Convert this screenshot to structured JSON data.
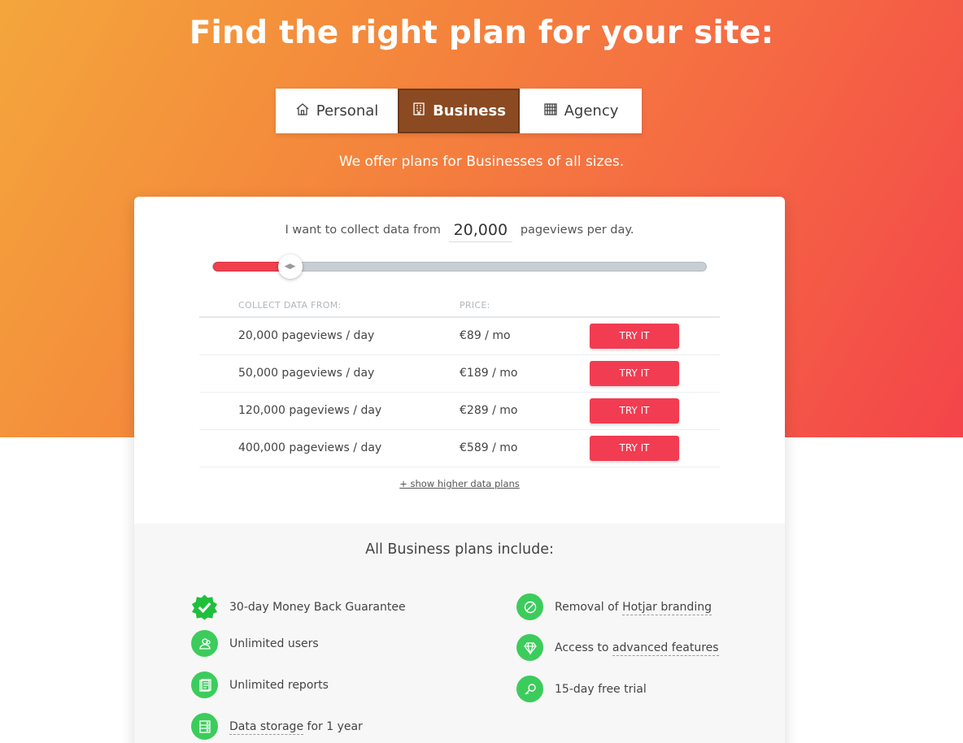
{
  "header": {
    "title": "Find the right plan for your site:",
    "subtitle": "We offer plans for Businesses of all sizes."
  },
  "tabs": [
    {
      "label": "Personal",
      "icon": "house-icon",
      "active": false
    },
    {
      "label": "Business",
      "icon": "office-building-icon",
      "active": true
    },
    {
      "label": "Agency",
      "icon": "skyscraper-icon",
      "active": false
    }
  ],
  "collector": {
    "prefix": "I want to collect data from",
    "value": "20,000",
    "suffix": "pageviews per day."
  },
  "slider": {
    "level": 0.156,
    "fill_color": "#f0404e"
  },
  "table": {
    "headers": [
      "COLLECT DATA FROM:",
      "PRICE:"
    ],
    "rows": [
      {
        "data": "20,000 pageviews / day",
        "price": "€89 / mo",
        "button": "TRY IT"
      },
      {
        "data": "50,000 pageviews / day",
        "price": "€189 / mo",
        "button": "TRY IT"
      },
      {
        "data": "120,000 pageviews / day",
        "price": "€289 / mo",
        "button": "TRY IT"
      },
      {
        "data": "400,000 pageviews / day",
        "price": "€589 / mo",
        "button": "TRY IT"
      }
    ],
    "show_more": "+ show higher data plans"
  },
  "includes": {
    "title": "All Business plans include:",
    "left": [
      {
        "icon": "verified-badge-icon",
        "text": "30-day Money Back Guarantee"
      },
      {
        "icon": "users-icon",
        "text": "Unlimited users"
      },
      {
        "icon": "reports-icon",
        "text": "Unlimited reports"
      },
      {
        "icon": "storage-icon",
        "text_a": "Data storage",
        "text_b": " for 1 year"
      }
    ],
    "right": [
      {
        "icon": "no-sign-icon",
        "text_a": "Removal of ",
        "text_b": "Hotjar branding"
      },
      {
        "icon": "diamond-icon",
        "text_a": "Access to ",
        "text_b": "advanced features"
      },
      {
        "icon": "key-icon",
        "text": "15-day free trial"
      }
    ]
  },
  "colors": {
    "accent": "#f23c52",
    "active_tab": "#8b4a22",
    "feature_green": "#3ccc5c"
  }
}
